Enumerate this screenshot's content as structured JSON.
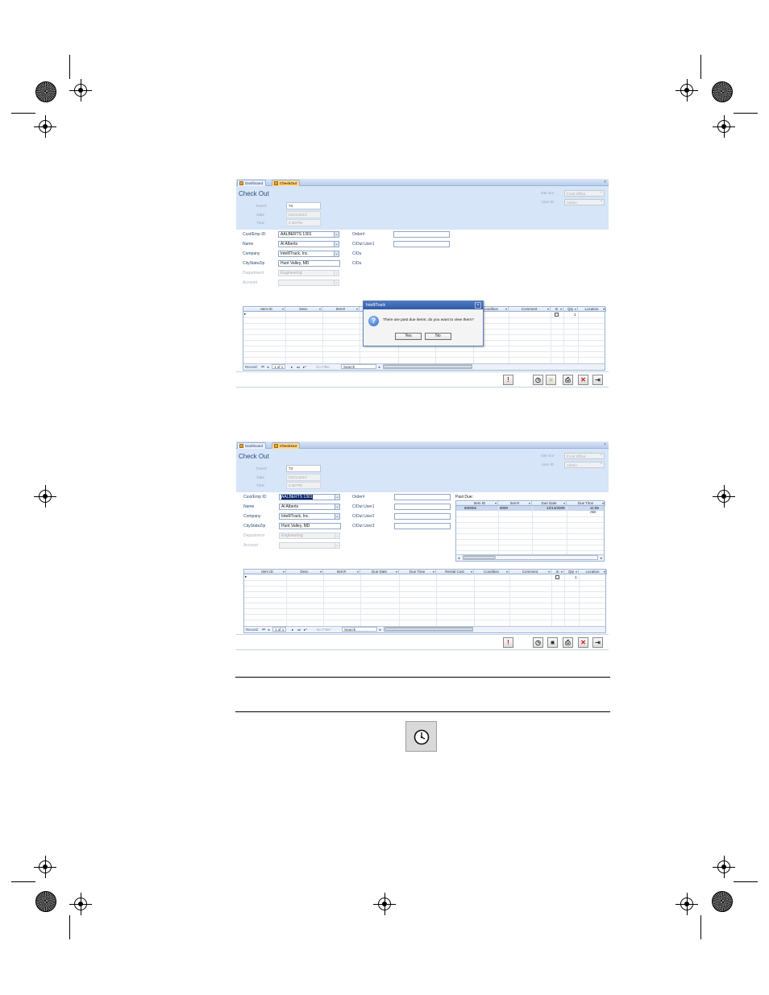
{
  "screen1": {
    "tabs": {
      "dashboard": "Dashboard",
      "checkout": "CheckOut"
    },
    "title": "Check Out",
    "trans_label": "Trans#",
    "trans_value": "73",
    "date_label": "Date",
    "date_value": "02/21/2010",
    "time_label": "Time",
    "time_value": "4:48 PM",
    "site_label": "Site Out",
    "site_value": "Front Office",
    "user_label": "User ID",
    "user_value": "Admin",
    "cust_label": "Cust/Emp ID",
    "cust_value": "AALBERTS 1301",
    "name_label": "Name",
    "name_value": "Al Alberts",
    "company_label": "Company",
    "company_value": "IntelliTrack, Inc.",
    "city_label": "CityStateZip",
    "city_value": "Hunt Valley, MD",
    "dept_label": "Department",
    "dept_value": "Engineering",
    "account_label": "Account",
    "order_label": "Order#",
    "user1_label": "ClOut User1",
    "user2_label": "ClOu",
    "user3_label": "ClOu",
    "dialog": {
      "title": "IntelliTrack",
      "message": "There are past due items; do you want to view them?",
      "yes": "Yes",
      "no": "No"
    }
  },
  "screen2": {
    "tabs": {
      "dashboard": "Dashboard",
      "checkout": "CheckOut"
    },
    "title": "Check Out",
    "trans_label": "Trans#",
    "trans_value": "73",
    "date_label": "Date",
    "date_value": "02/21/2010",
    "time_label": "Time",
    "time_value": "4:48 PM",
    "site_label": "Site Out",
    "site_value": "Front Office",
    "user_label": "User ID",
    "user_value": "Admin",
    "cust_label": "Cust/Emp ID",
    "cust_value": "AALBERTS 1301",
    "name_label": "Name",
    "name_value": "Al Alberts",
    "company_label": "Company",
    "company_value": "IntelliTrack, Inc.",
    "city_label": "CityStateZip",
    "city_value": "Hunt Valley, MD",
    "dept_label": "Department",
    "dept_value": "Engineering",
    "account_label": "Account",
    "order_label": "Order#",
    "user1_label": "ClOut User1",
    "user2_label": "ClOut User2",
    "user3_label": "ClOut User3",
    "past_due": {
      "label": "Past Due:",
      "columns": [
        "Item ID",
        "Item#",
        "Due Date",
        "Due Time"
      ],
      "row": [
        "600002",
        "6000",
        "12/14/2009",
        "11:05 AM"
      ]
    }
  },
  "grid": {
    "columns": [
      "Item ID",
      "Desc",
      "Item#",
      "Due Date",
      "Due Time",
      "Rental Cost",
      "Condition",
      "Comment",
      "In",
      "Qty",
      "Location"
    ],
    "qty_value": "1",
    "nav_record": "Record:",
    "nav_position": "1 of 1",
    "nav_filter": "No Filter",
    "nav_search": "Search"
  },
  "toolbar": {
    "alert": "!",
    "clock": "◷",
    "list": "≡",
    "stop": "■",
    "print": "⎙",
    "delete": "✕",
    "exit": "⇥"
  }
}
